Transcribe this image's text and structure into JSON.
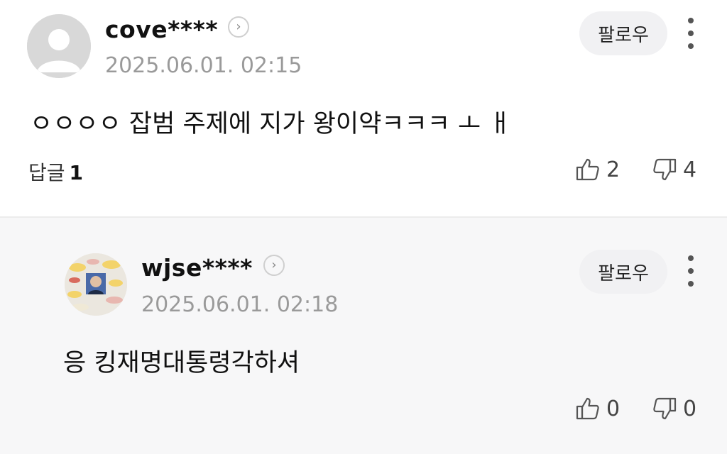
{
  "comments": [
    {
      "username": "cove****",
      "date": "2025.06.01. 02:15",
      "follow_label": "팔로우",
      "text": "ㅇㅇㅇㅇ 잡범 주제에 지가 왕이약ㅋㅋㅋ ㅗ ㅐ",
      "reply_label": "답글",
      "reply_count": "1",
      "likes": "2",
      "dislikes": "4",
      "avatar": "default-user-icon"
    },
    {
      "username": "wjse****",
      "date": "2025.06.01. 02:18",
      "follow_label": "팔로우",
      "text": "응 킹재명대통령각하셔",
      "likes": "0",
      "dislikes": "0",
      "avatar": "profile-photo"
    }
  ],
  "colors": {
    "background": "#ffffff",
    "reply_background": "#f7f7f8",
    "button_bg": "#f1f1f3",
    "muted_text": "#9a9a9a"
  }
}
